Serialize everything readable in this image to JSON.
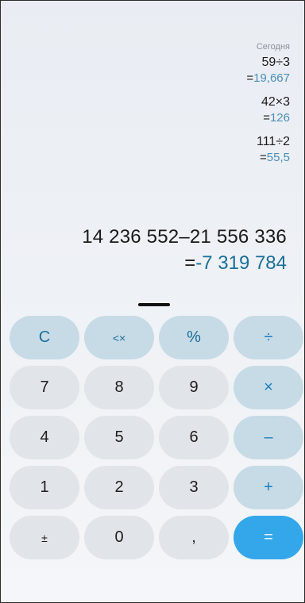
{
  "history": {
    "label": "Сегодня",
    "entries": [
      {
        "expression": "59÷3",
        "equals": "=",
        "result": "19,667"
      },
      {
        "expression": "42×3",
        "equals": "=",
        "result": "126"
      },
      {
        "expression": "111÷2",
        "equals": "=",
        "result": "55,5"
      }
    ]
  },
  "current": {
    "expression": "14 236 552–21 556 336",
    "equals": "=",
    "result": "-7 319 784"
  },
  "keys": {
    "clear": "C",
    "backspace": "<×",
    "percent": "%",
    "divide": "÷",
    "seven": "7",
    "eight": "8",
    "nine": "9",
    "multiply": "×",
    "four": "4",
    "five": "5",
    "six": "6",
    "minus": "–",
    "one": "1",
    "two": "2",
    "three": "3",
    "plus": "+",
    "sign": "±",
    "zero": "0",
    "decimal": ",",
    "equals": "="
  },
  "colors": {
    "accent": "#1b7fbf",
    "equals_key": "#34a7ea",
    "function_key": "#c7dbe6",
    "digit_key": "#e1e4e8"
  }
}
